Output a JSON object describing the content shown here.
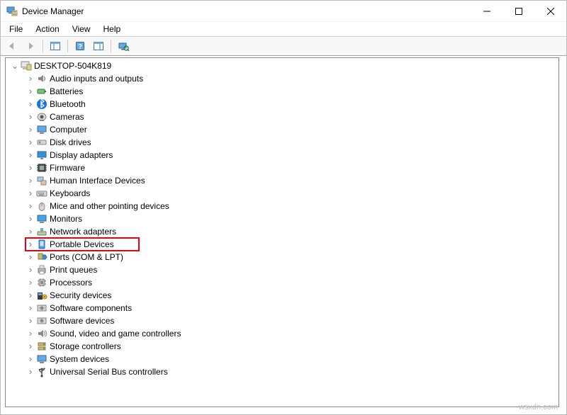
{
  "window": {
    "title": "Device Manager"
  },
  "menu": {
    "file": "File",
    "action": "Action",
    "view": "View",
    "help": "Help"
  },
  "tree": {
    "root": {
      "label": "DESKTOP-504K819"
    },
    "items": [
      {
        "label": "Audio inputs and outputs",
        "icon": "audio-icon"
      },
      {
        "label": "Batteries",
        "icon": "battery-icon"
      },
      {
        "label": "Bluetooth",
        "icon": "bluetooth-icon"
      },
      {
        "label": "Cameras",
        "icon": "camera-icon"
      },
      {
        "label": "Computer",
        "icon": "computer-icon"
      },
      {
        "label": "Disk drives",
        "icon": "disk-icon"
      },
      {
        "label": "Display adapters",
        "icon": "display-icon"
      },
      {
        "label": "Firmware",
        "icon": "firmware-icon"
      },
      {
        "label": "Human Interface Devices",
        "icon": "hid-icon"
      },
      {
        "label": "Keyboards",
        "icon": "keyboard-icon"
      },
      {
        "label": "Mice and other pointing devices",
        "icon": "mouse-icon"
      },
      {
        "label": "Monitors",
        "icon": "monitor-icon"
      },
      {
        "label": "Network adapters",
        "icon": "network-icon"
      },
      {
        "label": "Portable Devices",
        "icon": "portable-icon",
        "highlighted": true
      },
      {
        "label": "Ports (COM & LPT)",
        "icon": "ports-icon"
      },
      {
        "label": "Print queues",
        "icon": "printer-icon"
      },
      {
        "label": "Processors",
        "icon": "cpu-icon"
      },
      {
        "label": "Security devices",
        "icon": "security-icon"
      },
      {
        "label": "Software components",
        "icon": "swcomp-icon"
      },
      {
        "label": "Software devices",
        "icon": "swdev-icon"
      },
      {
        "label": "Sound, video and game controllers",
        "icon": "sound-icon"
      },
      {
        "label": "Storage controllers",
        "icon": "storage-icon"
      },
      {
        "label": "System devices",
        "icon": "system-icon"
      },
      {
        "label": "Universal Serial Bus controllers",
        "icon": "usb-icon"
      }
    ]
  },
  "watermark": "wsxdn.com"
}
